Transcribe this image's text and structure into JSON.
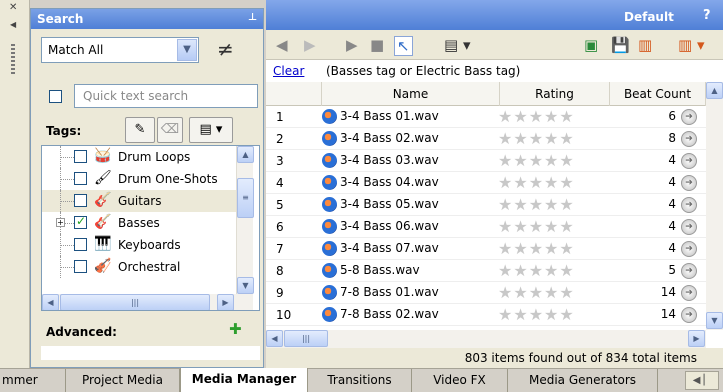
{
  "search_panel": {
    "title": "Search",
    "pin_icon": "pin-icon",
    "match_mode": "Match All",
    "match_options_visible": [
      "Match All"
    ],
    "not_equal_symbol": "≠",
    "quick_search_placeholder": "Quick text search",
    "tags_label": "Tags:",
    "tags": [
      {
        "label": "Drum Loops",
        "icon": "drum-icon",
        "checked": false,
        "expandable": false
      },
      {
        "label": "Drum One-Shots",
        "icon": "drumstick-icon",
        "checked": false,
        "expandable": false
      },
      {
        "label": "Guitars",
        "icon": "guitar-icon",
        "checked": false,
        "expandable": false,
        "selected": true
      },
      {
        "label": "Basses",
        "icon": "bass-icon",
        "checked": true,
        "expandable": true
      },
      {
        "label": "Keyboards",
        "icon": "keyboard-icon",
        "checked": false,
        "expandable": false
      },
      {
        "label": "Orchestral",
        "icon": "orchestral-icon",
        "checked": false,
        "expandable": false
      }
    ],
    "advanced_label": "Advanced:"
  },
  "header": {
    "layout_name": "Default",
    "help_label": "?"
  },
  "query": {
    "clear_label": "Clear",
    "text": "(Basses tag or Electric Bass tag)"
  },
  "grid": {
    "columns": [
      "",
      "Name",
      "Rating",
      "Beat Count"
    ],
    "rows": [
      {
        "num": "1",
        "name": "3-4 Bass 01.wav",
        "rating": 0,
        "beats": "6"
      },
      {
        "num": "2",
        "name": "3-4 Bass 02.wav",
        "rating": 0,
        "beats": "8"
      },
      {
        "num": "3",
        "name": "3-4 Bass 03.wav",
        "rating": 0,
        "beats": "4"
      },
      {
        "num": "4",
        "name": "3-4 Bass 04.wav",
        "rating": 0,
        "beats": "4"
      },
      {
        "num": "5",
        "name": "3-4 Bass 05.wav",
        "rating": 0,
        "beats": "4"
      },
      {
        "num": "6",
        "name": "3-4 Bass 06.wav",
        "rating": 0,
        "beats": "4"
      },
      {
        "num": "7",
        "name": "3-4 Bass 07.wav",
        "rating": 0,
        "beats": "4"
      },
      {
        "num": "8",
        "name": "5-8 Bass.wav",
        "rating": 0,
        "beats": "5"
      },
      {
        "num": "9",
        "name": "7-8 Bass 01.wav",
        "rating": 0,
        "beats": "14"
      },
      {
        "num": "10",
        "name": "7-8 Bass 02.wav",
        "rating": 0,
        "beats": "14"
      }
    ]
  },
  "status": {
    "text": "803 items found out of 834 total items"
  },
  "tabs": [
    {
      "label": "mmer",
      "active": false
    },
    {
      "label": "Project Media",
      "active": false
    },
    {
      "label": "Media Manager",
      "active": true
    },
    {
      "label": "Transitions",
      "active": false
    },
    {
      "label": "Video FX",
      "active": false
    },
    {
      "label": "Media Generators",
      "active": false
    }
  ],
  "colors": {
    "title_bar": "#4f7fd6",
    "link": "#0000cc",
    "check_on": "#21a121",
    "panel_bg": "#ece9d8"
  }
}
